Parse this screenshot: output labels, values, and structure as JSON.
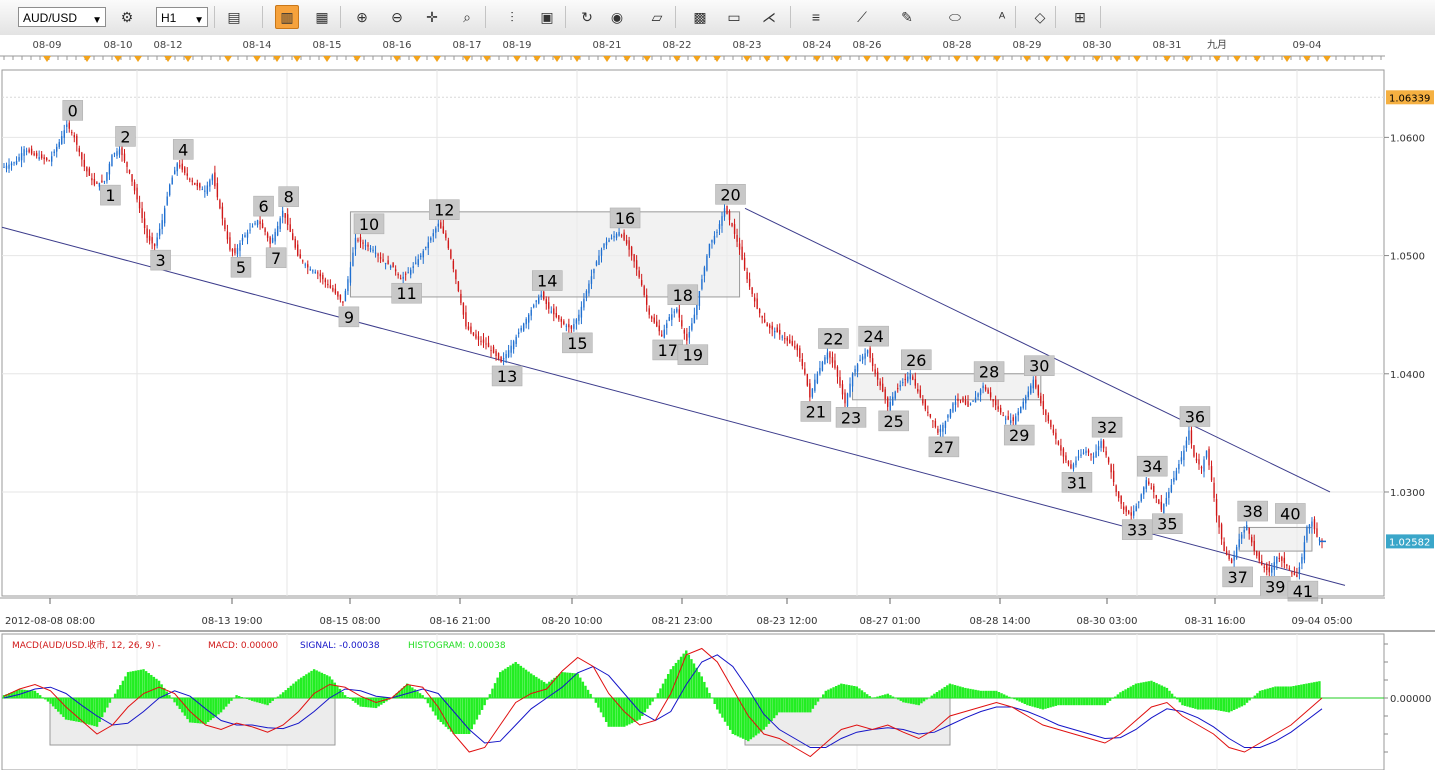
{
  "toolbar": {
    "symbol": "AUD/USD",
    "timeframe": "H1",
    "icons": [
      "bar-chart-icon",
      "candlestick-icon",
      "line-chart-icon",
      "zoom-in-icon",
      "zoom-out-icon",
      "crosshair-icon",
      "zoom-fit-icon",
      "period-separator-icon",
      "template-icon",
      "refresh-icon",
      "globe-icon",
      "ruler-icon",
      "image-icon",
      "print-icon",
      "fan-icon",
      "fibonacci-icon",
      "trendline-icon",
      "pencil-icon",
      "ellipse-icon",
      "text-label-icon",
      "eraser-icon",
      "layout-icon"
    ]
  },
  "top_dates": [
    "08-09",
    "08-10",
    "08-12",
    "08-14",
    "08-15",
    "08-16",
    "08-17",
    "08-19",
    "08-21",
    "08-22",
    "08-23",
    "08-24",
    "08-26",
    "08-28",
    "08-29",
    "08-30",
    "08-31",
    "九月",
    "09-04"
  ],
  "bottom_dates": [
    "2012-08-08 08:00",
    "08-13 19:00",
    "08-15 08:00",
    "08-16 21:00",
    "08-20 10:00",
    "08-21 23:00",
    "08-23 12:00",
    "08-27 01:00",
    "08-28 14:00",
    "08-30 03:00",
    "08-31 16:00",
    "09-04 05:00"
  ],
  "price_axis": {
    "ticks": [
      "1.0600",
      "1.0500",
      "1.0400",
      "1.0300"
    ],
    "high_label": "1.06339",
    "current_label": "1.02582",
    "high_color": "#f5b041",
    "current_color": "#3aa6c9"
  },
  "wave_labels": [
    "0",
    "1",
    "2",
    "3",
    "4",
    "5",
    "6",
    "7",
    "8",
    "9",
    "10",
    "11",
    "12",
    "13",
    "14",
    "15",
    "16",
    "17",
    "18",
    "19",
    "20",
    "21",
    "22",
    "23",
    "24",
    "25",
    "26",
    "27",
    "28",
    "29",
    "30",
    "31",
    "32",
    "33",
    "34",
    "35",
    "36",
    "37",
    "38",
    "39",
    "40",
    "41"
  ],
  "macd": {
    "title": "MACD(AUD/USD.收市, 12, 26, 9) -",
    "macd_label": "MACD: 0.00000",
    "signal_label": "SIGNAL: -0.00038",
    "hist_label": "HISTOGRAM: 0.00038",
    "zero_label": "0.00000",
    "colors": {
      "macd": "#e01010",
      "signal": "#1515c8",
      "histogram": "#22ee22"
    }
  },
  "chart_data": {
    "type": "candlestick",
    "symbol": "AUD/USD",
    "timeframe": "H1",
    "x_range": [
      "2012-08-08 08:00",
      "09-04 05:00"
    ],
    "ylim": [
      1.0212,
      1.0657
    ],
    "high_marker": 1.06339,
    "last_price": 1.02582,
    "grid": true,
    "wave_points": [
      {
        "label": "0",
        "price": 1.0611
      },
      {
        "label": "1",
        "price": 1.0563
      },
      {
        "label": "2",
        "price": 1.0589
      },
      {
        "label": "3",
        "price": 1.0508
      },
      {
        "label": "4",
        "price": 1.0578
      },
      {
        "label": "5",
        "price": 1.0502
      },
      {
        "label": "6",
        "price": 1.053
      },
      {
        "label": "7",
        "price": 1.051
      },
      {
        "label": "8",
        "price": 1.0538
      },
      {
        "label": "9",
        "price": 1.046
      },
      {
        "label": "10",
        "price": 1.0515
      },
      {
        "label": "11",
        "price": 1.048
      },
      {
        "label": "12",
        "price": 1.0527
      },
      {
        "label": "13",
        "price": 1.041
      },
      {
        "label": "14",
        "price": 1.0467
      },
      {
        "label": "15",
        "price": 1.0438
      },
      {
        "label": "16",
        "price": 1.052
      },
      {
        "label": "17",
        "price": 1.0432
      },
      {
        "label": "18",
        "price": 1.0455
      },
      {
        "label": "19",
        "price": 1.0428
      },
      {
        "label": "20",
        "price": 1.054
      },
      {
        "label": "21",
        "price": 1.038
      },
      {
        "label": "22",
        "price": 1.0418
      },
      {
        "label": "23",
        "price": 1.0375
      },
      {
        "label": "24",
        "price": 1.042
      },
      {
        "label": "25",
        "price": 1.0372
      },
      {
        "label": "26",
        "price": 1.04
      },
      {
        "label": "27",
        "price": 1.035
      },
      {
        "label": "28",
        "price": 1.039
      },
      {
        "label": "29",
        "price": 1.036
      },
      {
        "label": "30",
        "price": 1.0395
      },
      {
        "label": "31",
        "price": 1.032
      },
      {
        "label": "32",
        "price": 1.0343
      },
      {
        "label": "33",
        "price": 1.028
      },
      {
        "label": "34",
        "price": 1.031
      },
      {
        "label": "35",
        "price": 1.0285
      },
      {
        "label": "36",
        "price": 1.0352
      },
      {
        "label": "37",
        "price": 1.024
      },
      {
        "label": "38",
        "price": 1.0272
      },
      {
        "label": "39",
        "price": 1.0232
      },
      {
        "label": "40",
        "price": 1.027
      },
      {
        "label": "41",
        "price": 1.0228
      }
    ],
    "price_path": [
      [
        0,
        1.0575
      ],
      [
        5,
        1.058
      ],
      [
        8,
        1.059
      ],
      [
        12,
        1.0585
      ],
      [
        18,
        1.058
      ],
      [
        22,
        1.0596
      ],
      [
        25,
        1.0611
      ],
      [
        28,
        1.06
      ],
      [
        32,
        1.0575
      ],
      [
        36,
        1.056
      ],
      [
        40,
        1.0563
      ],
      [
        43,
        1.0585
      ],
      [
        46,
        1.059
      ],
      [
        50,
        1.057
      ],
      [
        54,
        1.054
      ],
      [
        57,
        1.0515
      ],
      [
        60,
        1.0508
      ],
      [
        63,
        1.053
      ],
      [
        66,
        1.056
      ],
      [
        69,
        1.0578
      ],
      [
        72,
        1.057
      ],
      [
        76,
        1.056
      ],
      [
        80,
        1.0555
      ],
      [
        83,
        1.0568
      ],
      [
        86,
        1.054
      ],
      [
        90,
        1.0505
      ],
      [
        92,
        1.0502
      ],
      [
        95,
        1.0515
      ],
      [
        98,
        1.0522
      ],
      [
        101,
        1.053
      ],
      [
        104,
        1.052
      ],
      [
        106,
        1.051
      ],
      [
        109,
        1.0525
      ],
      [
        111,
        1.0538
      ],
      [
        114,
        1.052
      ],
      [
        117,
        1.05
      ],
      [
        121,
        1.049
      ],
      [
        125,
        1.0485
      ],
      [
        129,
        1.0475
      ],
      [
        132,
        1.0468
      ],
      [
        135,
        1.046
      ],
      [
        138,
        1.049
      ],
      [
        140,
        1.0515
      ],
      [
        143,
        1.051
      ],
      [
        147,
        1.0505
      ],
      [
        151,
        1.0495
      ],
      [
        155,
        1.049
      ],
      [
        158,
        1.048
      ],
      [
        162,
        1.0488
      ],
      [
        166,
        1.05
      ],
      [
        170,
        1.0515
      ],
      [
        173,
        1.0527
      ],
      [
        176,
        1.0515
      ],
      [
        180,
        1.048
      ],
      [
        184,
        1.044
      ],
      [
        188,
        1.043
      ],
      [
        192,
        1.0425
      ],
      [
        196,
        1.0415
      ],
      [
        198,
        1.041
      ],
      [
        201,
        1.042
      ],
      [
        205,
        1.0435
      ],
      [
        209,
        1.045
      ],
      [
        212,
        1.0462
      ],
      [
        214,
        1.0467
      ],
      [
        217,
        1.0455
      ],
      [
        220,
        1.0448
      ],
      [
        223,
        1.0442
      ],
      [
        226,
        1.0438
      ],
      [
        229,
        1.045
      ],
      [
        232,
        1.047
      ],
      [
        236,
        1.0495
      ],
      [
        239,
        1.051
      ],
      [
        242,
        1.0515
      ],
      [
        245,
        1.052
      ],
      [
        248,
        1.051
      ],
      [
        251,
        1.0495
      ],
      [
        254,
        1.0475
      ],
      [
        257,
        1.045
      ],
      [
        260,
        1.044
      ],
      [
        262,
        1.0432
      ],
      [
        265,
        1.0448
      ],
      [
        268,
        1.0455
      ],
      [
        270,
        1.044
      ],
      [
        272,
        1.0428
      ],
      [
        275,
        1.045
      ],
      [
        278,
        1.048
      ],
      [
        281,
        1.051
      ],
      [
        284,
        1.052
      ],
      [
        287,
        1.054
      ],
      [
        290,
        1.0525
      ],
      [
        293,
        1.0505
      ],
      [
        296,
        1.048
      ],
      [
        300,
        1.0455
      ],
      [
        304,
        1.044
      ],
      [
        308,
        1.0435
      ],
      [
        312,
        1.0428
      ],
      [
        316,
        1.042
      ],
      [
        319,
        1.04
      ],
      [
        321,
        1.038
      ],
      [
        323,
        1.0395
      ],
      [
        326,
        1.041
      ],
      [
        328,
        1.0418
      ],
      [
        331,
        1.0405
      ],
      [
        333,
        1.039
      ],
      [
        335,
        1.0375
      ],
      [
        338,
        1.04
      ],
      [
        341,
        1.0412
      ],
      [
        344,
        1.042
      ],
      [
        347,
        1.04
      ],
      [
        350,
        1.0385
      ],
      [
        352,
        1.0372
      ],
      [
        355,
        1.0385
      ],
      [
        358,
        1.0393
      ],
      [
        361,
        1.04
      ],
      [
        364,
        1.0385
      ],
      [
        367,
        1.037
      ],
      [
        370,
        1.036
      ],
      [
        372,
        1.035
      ],
      [
        375,
        1.036
      ],
      [
        378,
        1.0375
      ],
      [
        381,
        1.0378
      ],
      [
        384,
        1.0372
      ],
      [
        387,
        1.038
      ],
      [
        390,
        1.039
      ],
      [
        393,
        1.038
      ],
      [
        396,
        1.037
      ],
      [
        399,
        1.0362
      ],
      [
        402,
        1.036
      ],
      [
        405,
        1.0372
      ],
      [
        408,
        1.0385
      ],
      [
        410,
        1.0395
      ],
      [
        413,
        1.0375
      ],
      [
        416,
        1.036
      ],
      [
        419,
        1.0345
      ],
      [
        422,
        1.033
      ],
      [
        425,
        1.032
      ],
      [
        428,
        1.033
      ],
      [
        431,
        1.0335
      ],
      [
        434,
        1.033
      ],
      [
        437,
        1.0343
      ],
      [
        440,
        1.0325
      ],
      [
        443,
        1.03
      ],
      [
        446,
        1.0285
      ],
      [
        449,
        1.028
      ],
      [
        452,
        1.0292
      ],
      [
        455,
        1.031
      ],
      [
        458,
        1.03
      ],
      [
        461,
        1.0285
      ],
      [
        464,
        1.03
      ],
      [
        467,
        1.0318
      ],
      [
        470,
        1.0335
      ],
      [
        472,
        1.0352
      ],
      [
        474,
        1.033
      ],
      [
        477,
        1.032
      ],
      [
        479,
        1.0335
      ],
      [
        481,
        1.031
      ],
      [
        483,
        1.028
      ],
      [
        486,
        1.025
      ],
      [
        489,
        1.024
      ],
      [
        492,
        1.026
      ],
      [
        495,
        1.0272
      ],
      [
        498,
        1.025
      ],
      [
        501,
        1.0238
      ],
      [
        504,
        1.0232
      ],
      [
        507,
        1.0245
      ],
      [
        510,
        1.024
      ],
      [
        513,
        1.0232
      ],
      [
        515,
        1.0228
      ],
      [
        517,
        1.0245
      ],
      [
        519,
        1.027
      ],
      [
        521,
        1.0275
      ],
      [
        523,
        1.0262
      ],
      [
        525,
        1.0258
      ]
    ],
    "macd_series": {
      "macd": [
        0.0002,
        0.001,
        0.0015,
        0.0008,
        -0.001,
        -0.0025,
        -0.004,
        -0.003,
        -0.001,
        0.0005,
        0.0012,
        0.0005,
        -0.0015,
        -0.003,
        -0.0035,
        -0.0028,
        -0.0032,
        -0.0038,
        -0.003,
        -0.0015,
        0.0005,
        0.0015,
        0.0012,
        0.0002,
        -0.0005,
        0.0,
        0.0015,
        0.0012,
        -0.001,
        -0.004,
        -0.006,
        -0.0055,
        -0.003,
        -0.0005,
        0.0005,
        0.001,
        0.003,
        0.0045,
        0.0035,
        0.0005,
        -0.0015,
        -0.003,
        -0.0025,
        0.0005,
        0.0048,
        0.0055,
        0.004,
        0.001,
        -0.002,
        -0.004,
        -0.0045,
        -0.0055,
        -0.0065,
        -0.005,
        -0.0035,
        -0.003,
        -0.0035,
        -0.003,
        -0.0038,
        -0.0045,
        -0.0035,
        -0.002,
        -0.0015,
        -0.001,
        -0.0005,
        -0.001,
        -0.002,
        -0.003,
        -0.0035,
        -0.004,
        -0.0045,
        -0.005,
        -0.004,
        -0.0025,
        -0.001,
        -0.0005,
        -0.002,
        -0.003,
        -0.004,
        -0.0055,
        -0.006,
        -0.005,
        -0.004,
        -0.003,
        -0.0015,
        0.0
      ],
      "signal": [
        0.0,
        0.0004,
        0.001,
        0.0012,
        0.0005,
        -0.0008,
        -0.002,
        -0.003,
        -0.0028,
        -0.0015,
        0.0,
        0.0008,
        0.0002,
        -0.0012,
        -0.0025,
        -0.003,
        -0.003,
        -0.0033,
        -0.0034,
        -0.0028,
        -0.0015,
        0.0,
        0.001,
        0.0008,
        0.0002,
        0.0,
        0.0005,
        0.001,
        0.0005,
        -0.0015,
        -0.0035,
        -0.005,
        -0.0048,
        -0.003,
        -0.0012,
        0.0,
        0.0012,
        0.0028,
        0.0035,
        0.0025,
        0.0005,
        -0.0015,
        -0.0025,
        -0.0015,
        0.0015,
        0.004,
        0.0048,
        0.0035,
        0.001,
        -0.0018,
        -0.0035,
        -0.0045,
        -0.0055,
        -0.0055,
        -0.0045,
        -0.0038,
        -0.0035,
        -0.0033,
        -0.0035,
        -0.004,
        -0.0038,
        -0.003,
        -0.0022,
        -0.0015,
        -0.001,
        -0.001,
        -0.0015,
        -0.0022,
        -0.003,
        -0.0035,
        -0.004,
        -0.0045,
        -0.0044,
        -0.0035,
        -0.0022,
        -0.0012,
        -0.0015,
        -0.0022,
        -0.0032,
        -0.0045,
        -0.0055,
        -0.0055,
        -0.0048,
        -0.0038,
        -0.0025,
        -0.0012
      ]
    }
  }
}
